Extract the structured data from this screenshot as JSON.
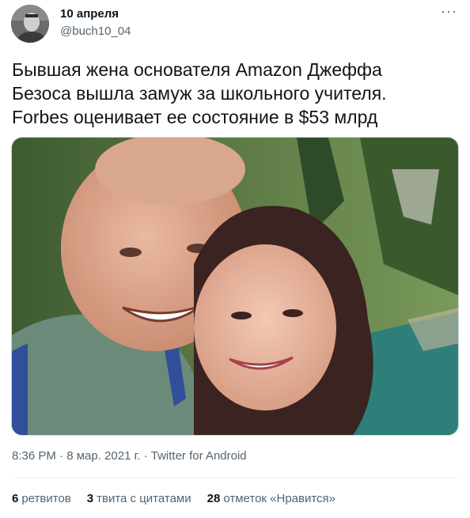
{
  "author": {
    "display_name": "10 апреля",
    "handle": "@buch10_04",
    "avatar_icon": "user-avatar-icon"
  },
  "more_icon": "···",
  "tweet_text": "Бывшая жена основателя Amazon Джеффа\nБезоса вышла замуж за школьного учителя.\nForbes оценивает ее состояние в $53 млрд",
  "photo": {
    "description_icon": "photo-icon"
  },
  "meta": {
    "time": "8:36 PM",
    "sep1": " · ",
    "date": "8 мар. 2021 г.",
    "sep2": " · ",
    "source": "Twitter for Android"
  },
  "stats": {
    "retweets_count": "6",
    "retweets_label": "ретвитов",
    "quotes_count": "3",
    "quotes_label": "твита с цитатами",
    "likes_count": "28",
    "likes_label": "отметок «Нравится»"
  },
  "colors": {
    "text_primary": "#0f1419",
    "text_secondary": "#536471",
    "border": "#cfd9de"
  }
}
